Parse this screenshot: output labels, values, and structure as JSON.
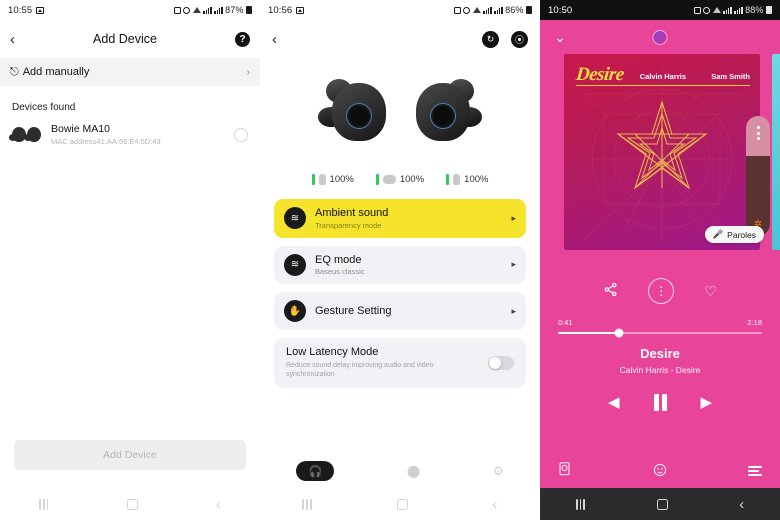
{
  "panel1": {
    "status": {
      "time": "10:55",
      "battery": "87%"
    },
    "header": {
      "back": "‹",
      "title": "Add Device",
      "help": "?"
    },
    "add_manually": {
      "icon": "⎋",
      "label": "Add manually",
      "chevron": "›"
    },
    "section_label": "Devices found",
    "device": {
      "name": "Bowie MA10",
      "mac": "MAC address41:AA:66:E4:5D:43"
    },
    "add_device_button": "Add Device"
  },
  "panel2": {
    "status": {
      "time": "10:56",
      "battery": "86%"
    },
    "header": {
      "back": "‹",
      "action1": "↻",
      "action2": "⦿"
    },
    "battery": [
      {
        "label": "100%",
        "kind": "left-bud"
      },
      {
        "label": "100%",
        "kind": "case"
      },
      {
        "label": "100%",
        "kind": "right-bud"
      }
    ],
    "cards": [
      {
        "title": "Ambient sound",
        "subtitle": "Transparency mode",
        "icon": "≋",
        "chevron": "▸",
        "accent": true
      },
      {
        "title": "EQ mode",
        "subtitle": "Baseus classic",
        "icon": "≋",
        "chevron": "▸",
        "accent": false
      },
      {
        "title": "Gesture Setting",
        "subtitle": "",
        "icon": "✋",
        "chevron": "▸",
        "accent": false
      }
    ],
    "low_latency": {
      "title": "Low Latency Mode",
      "subtitle": "Reduce sound delay improving audio and video synchronization",
      "enabled": false
    },
    "tabs": [
      {
        "name": "device",
        "icon": "🎧",
        "active": true
      },
      {
        "name": "find",
        "icon": "⬤",
        "active": false
      },
      {
        "name": "settings",
        "icon": "⚙",
        "active": false
      }
    ]
  },
  "panel3": {
    "status": {
      "time": "10:50",
      "battery": "88%"
    },
    "collapse": "⌄",
    "album": {
      "title": "Desire",
      "artist1": "Calvin Harris",
      "artist2": "Sam Smith"
    },
    "lyrics_chip": {
      "icon": "🎤",
      "label": "Paroles"
    },
    "icon_row": {
      "share": "⤳",
      "more": "⋮",
      "like": "♡"
    },
    "seek": {
      "current": "0:41",
      "total": "2:18",
      "progress_pct": 30
    },
    "track": {
      "title": "Desire",
      "subtitle": "Calvin Harris - Desire"
    },
    "transport": {
      "previous": "◀",
      "play_state": "pause",
      "next": "▶"
    },
    "bottom": {
      "cast": "◉",
      "mood": "☻",
      "queue": "queue-icon"
    }
  },
  "colors": {
    "accent_yellow": "#f5e32c",
    "player_pink": "#e8449a",
    "battery_green": "#35c759",
    "album_gold": "#f2e03c"
  },
  "navbar": {
    "recents": "|||",
    "home": "◯",
    "back": "‹"
  }
}
